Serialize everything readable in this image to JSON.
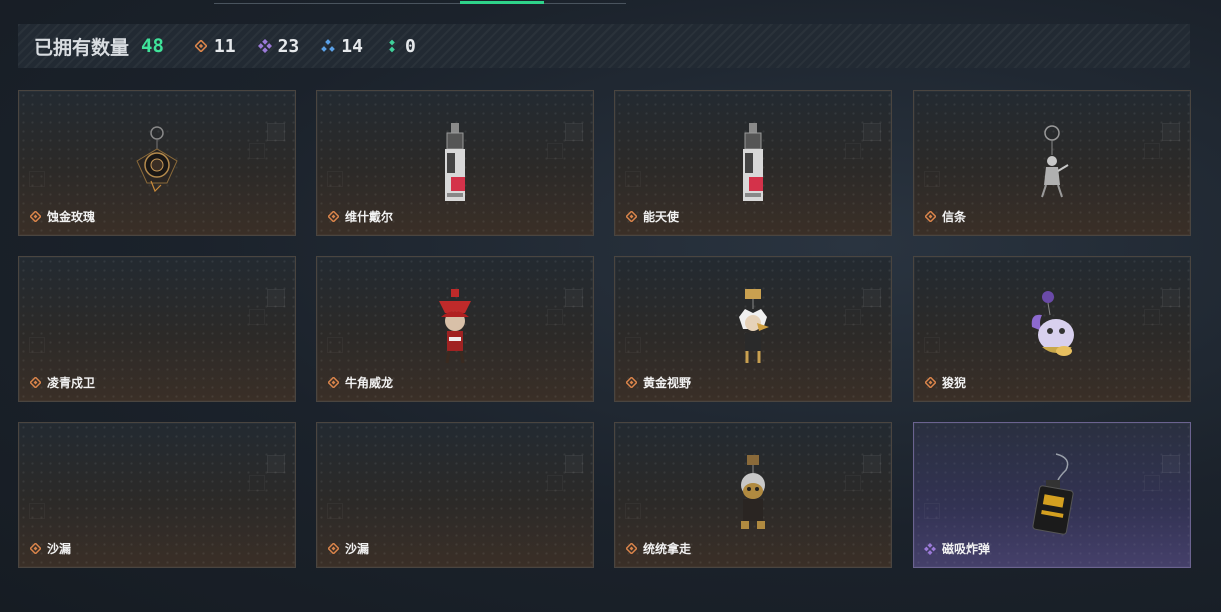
{
  "stats": {
    "owned_label": "已拥有数量",
    "owned_count": "48",
    "orange_count": "11",
    "purple_count": "23",
    "blue_count": "14",
    "green_count": "0"
  },
  "colors": {
    "orange": "#d9844a",
    "purple": "#9b7ad8",
    "blue": "#5aa0e6",
    "green": "#3fd19a",
    "accent": "#2fd38a"
  },
  "items": [
    {
      "name": "蚀金玫瑰",
      "rarity": "orange",
      "icon": "black-rose-charm-icon"
    },
    {
      "name": "维什戴尔",
      "rarity": "orange",
      "icon": "red-tag-charm-icon"
    },
    {
      "name": "能天使",
      "rarity": "orange",
      "icon": "red-tag-charm-icon"
    },
    {
      "name": "信条",
      "rarity": "orange",
      "icon": "silver-figure-charm-icon"
    },
    {
      "name": "凌青戍卫",
      "rarity": "orange",
      "icon": ""
    },
    {
      "name": "牛角威龙",
      "rarity": "orange",
      "icon": "red-hat-figure-charm-icon"
    },
    {
      "name": "黄金视野",
      "rarity": "orange",
      "icon": "white-hair-figure-charm-icon"
    },
    {
      "name": "狻猊",
      "rarity": "orange",
      "icon": "purple-lion-charm-icon"
    },
    {
      "name": "沙漏",
      "rarity": "orange",
      "icon": ""
    },
    {
      "name": "沙漏",
      "rarity": "orange",
      "icon": ""
    },
    {
      "name": "统统拿走",
      "rarity": "orange",
      "icon": "masked-figure-charm-icon"
    },
    {
      "name": "磁吸炸弹",
      "rarity": "purple",
      "icon": "bomb-device-charm-icon"
    }
  ]
}
